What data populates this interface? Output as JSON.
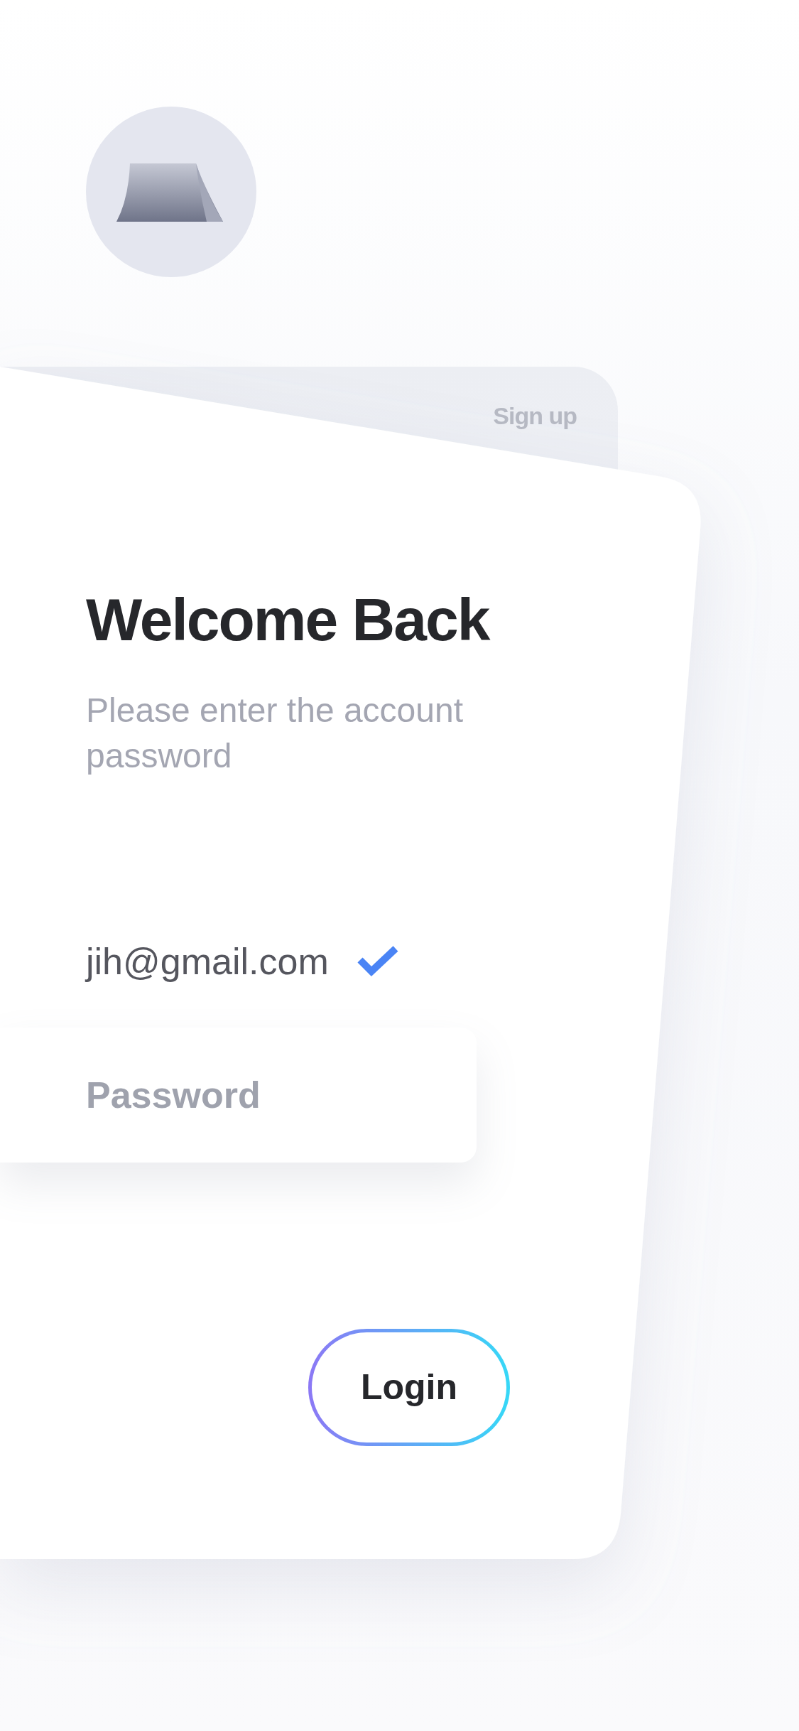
{
  "header": {
    "signup_link": "Sign up"
  },
  "form": {
    "title": "Welcome Back",
    "subtitle": "Please enter the account password",
    "email": {
      "value": "jih@gmail.com",
      "valid": true
    },
    "password": {
      "placeholder": "Password"
    },
    "login_button": "Login"
  }
}
